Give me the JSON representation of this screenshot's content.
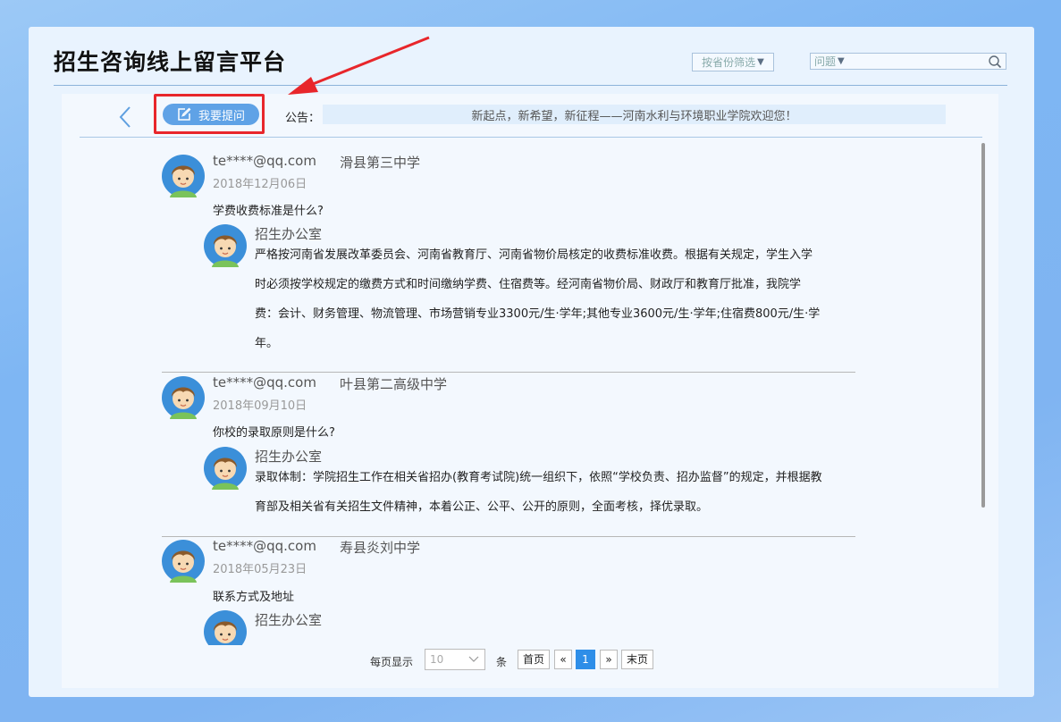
{
  "app_title": "招生咨询线上留言平台",
  "filters": {
    "province_label": "按省份筛选",
    "search_placeholder": "问题"
  },
  "toolbar": {
    "ask_label": "我要提问",
    "notice_label": "公告：",
    "notice_text": "新起点，新希望，新征程——河南水利与环境职业学院欢迎您！"
  },
  "posts": [
    {
      "user": "te****@qq.com",
      "school": "滑县第三中学",
      "date": "2018年12月06日",
      "question": "学费收费标准是什么?",
      "reply_from": "招生办公室",
      "reply": "严格按河南省发展改革委员会、河南省教育厅、河南省物价局核定的收费标准收费。根据有关规定，学生入学时必须按学校规定的缴费方式和时间缴纳学费、住宿费等。经河南省物价局、财政厅和教育厅批准，我院学费：会计、财务管理、物流管理、市场营销专业3300元/生·学年;其他专业3600元/生·学年;住宿费800元/生·学年。"
    },
    {
      "user": "te****@qq.com",
      "school": "叶县第二高级中学",
      "date": "2018年09月10日",
      "question": "你校的录取原则是什么?",
      "reply_from": "招生办公室",
      "reply": "录取体制：学院招生工作在相关省招办(教育考试院)统一组织下，依照“学校负责、招办监督”的规定，并根据教育部及相关省有关招生文件精神，本着公正、公平、公开的原则，全面考核，择优录取。"
    },
    {
      "user": "te****@qq.com",
      "school": "寿县炎刘中学",
      "date": "2018年05月23日",
      "question": "联系方式及地址",
      "reply_from": "招生办公室",
      "reply": ""
    }
  ],
  "pagination": {
    "per_page_label": "每页显示",
    "per_page_value": "10",
    "unit_label": "条",
    "first_label": "首页",
    "prev_label": "«",
    "current_page": "1",
    "next_label": "»",
    "last_label": "末页"
  },
  "colors": {
    "accent": "#5fa2e6",
    "highlight": "#e8262b",
    "active_page": "#2e8ee8"
  }
}
